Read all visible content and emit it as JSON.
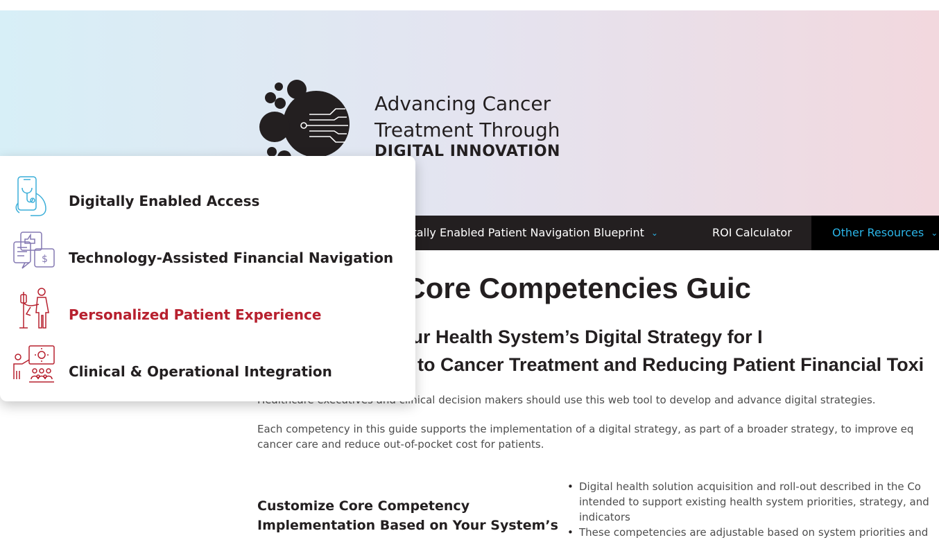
{
  "header": {
    "logo_line1": "Advancing Cancer",
    "logo_line2": "Treatment Through",
    "logo_line3": "DIGITAL INNOVATION"
  },
  "nav": {
    "items": [
      {
        "label": "itally Enabled Patient Navigation Blueprint",
        "has_caret": true
      },
      {
        "label": "ROI Calculator",
        "has_caret": false
      },
      {
        "label": "Other Resources",
        "has_caret": true,
        "active": true
      }
    ],
    "caret_icon": "chevron-down-icon"
  },
  "dropdown": {
    "items": [
      {
        "label": "Digitally Enabled Access",
        "icon": "smartphone-stethoscope-icon",
        "color": "#231f20"
      },
      {
        "label": "Technology-Assisted Financial Navigation",
        "icon": "financial-chat-icon",
        "color": "#231f20"
      },
      {
        "label": "Personalized Patient Experience",
        "icon": "patient-iv-icon",
        "color": "#b7202e",
        "highlighted": true
      },
      {
        "label": "Clinical & Operational Integration",
        "icon": "presentation-team-icon",
        "color": "#231f20"
      }
    ]
  },
  "main": {
    "title": "th System Core Competencies Guic",
    "subtitle_line1": "evelopment of Your Health System’s Digital Strategy for I",
    "subtitle_line2": "to Cancer Treatment and Reducing Patient Financial Toxi",
    "para1": "Healthcare executives and clinical decision makers should use this web tool to develop and advance digital strategies.",
    "para2_line1": "Each competency in this guide supports the implementation of a digital strategy, as part of a broader strategy, to improve eq",
    "para2_line2": "cancer care and reduce out-of-pocket cost for patients.",
    "section_heading_line1": "Customize Core Competency",
    "section_heading_line2": "Implementation Based on Your System’s",
    "bullets": [
      "Digital health solution acquisition and roll-out described in the Co",
      "intended to support existing health system priorities, strategy, and",
      "indicators",
      "These competencies are adjustable based on system priorities and"
    ]
  },
  "colors": {
    "accent_blue": "#2bb5e8",
    "accent_red": "#b7202e",
    "nav_bg": "#231f20",
    "icon_blue": "#3aaed8",
    "icon_purple": "#8478b2"
  }
}
